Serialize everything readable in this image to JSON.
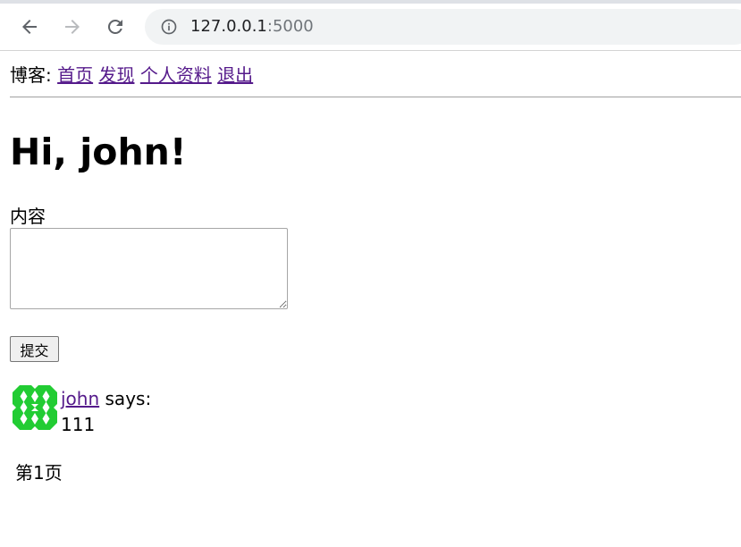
{
  "browser": {
    "url_host": "127.0.0.1",
    "url_port": ":5000"
  },
  "nav": {
    "prefix": "博客:",
    "links": [
      "首页",
      "发现",
      "个人资料",
      "退出"
    ]
  },
  "main": {
    "greeting": "Hi, john!",
    "content_label": "内容",
    "content_value": "",
    "submit_label": "提交"
  },
  "posts": [
    {
      "author": "john",
      "says": "says:",
      "body": "111"
    }
  ],
  "pagination": {
    "label": "第1页"
  },
  "colors": {
    "visited_link": "#551a8b",
    "avatar_green": "#22cc33"
  },
  "icons": {
    "back": "arrow-left-icon",
    "forward": "arrow-right-icon",
    "reload": "reload-icon",
    "info": "info-icon"
  }
}
